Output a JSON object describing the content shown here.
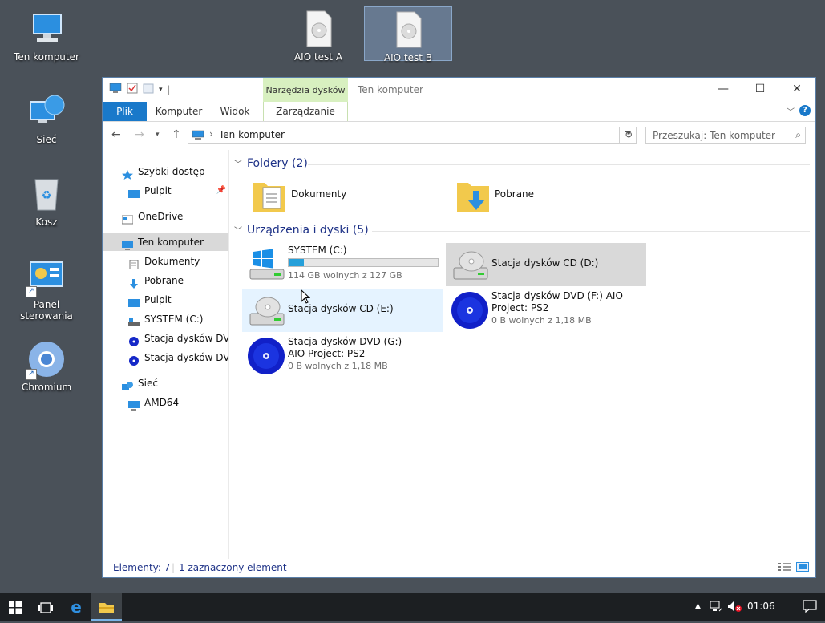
{
  "desktop": {
    "icons": [
      {
        "label": "Ten komputer"
      },
      {
        "label": "Sieć"
      },
      {
        "label": "Kosz"
      },
      {
        "label": "Panel sterowania"
      },
      {
        "label": "Chromium"
      },
      {
        "label": "AIO test A"
      },
      {
        "label": "AIO test B"
      }
    ]
  },
  "window": {
    "title": "Ten komputer",
    "context_tab_group": "Narzędzia dysków",
    "tabs": [
      "Plik",
      "Komputer",
      "Widok",
      "Zarządzanie"
    ],
    "help": "?",
    "address": {
      "path": "Ten komputer"
    },
    "search": {
      "placeholder": "Przeszukaj: Ten komputer"
    },
    "nav": [
      {
        "label": "Szybki dostęp"
      },
      {
        "label": "Pulpit"
      },
      {
        "label": "OneDrive"
      },
      {
        "label": "Ten komputer"
      },
      {
        "label": "Dokumenty"
      },
      {
        "label": "Pobrane"
      },
      {
        "label": "Pulpit"
      },
      {
        "label": "SYSTEM (C:)"
      },
      {
        "label": "Stacja dysków DVD"
      },
      {
        "label": "Stacja dysków DVD"
      },
      {
        "label": "Sieć"
      },
      {
        "label": "AMD64"
      }
    ],
    "groups": {
      "folders": {
        "title": "Foldery (2)"
      },
      "devices": {
        "title": "Urządzenia i dyski (5)"
      }
    },
    "folders": [
      {
        "name": "Dokumenty"
      },
      {
        "name": "Pobrane"
      }
    ],
    "drives": [
      {
        "name": "SYSTEM (C:)",
        "detail": "114 GB wolnych z 127 GB",
        "used_fraction": 0.1
      },
      {
        "name": "Stacja dysków CD (D:)"
      },
      {
        "name": "Stacja dysków CD (E:)"
      },
      {
        "name": "Stacja dysków DVD (F:) AIO Project: PS2",
        "detail": "0 B wolnych z 1,18 MB"
      },
      {
        "name": "Stacja dysków DVD (G:) AIO Project: PS2",
        "detail": "0 B wolnych z 1,18 MB"
      }
    ],
    "status": {
      "items": "Elementy: 7",
      "selected": "1 zaznaczony element"
    }
  },
  "taskbar": {
    "clock": "01:06"
  },
  "colors": {
    "accent": "#1979ca",
    "context_tab": "#d8f0c0",
    "desktop": "#4a5159",
    "taskbar": "#1c1f22"
  }
}
